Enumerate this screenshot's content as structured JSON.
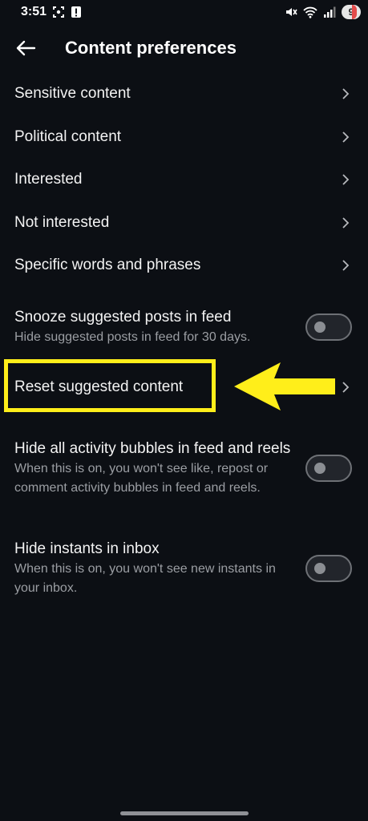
{
  "status_bar": {
    "time": "3:51",
    "battery_level": "9",
    "left_icons": [
      "screenshot-icon",
      "alert-icon"
    ],
    "right_icons": [
      "mute-icon",
      "wifi-icon",
      "signal-icon"
    ]
  },
  "header": {
    "title": "Content preferences",
    "back_icon": "back-arrow-icon"
  },
  "rows": [
    {
      "label": "Sensitive content",
      "control": "chevron"
    },
    {
      "label": "Political content",
      "control": "chevron"
    },
    {
      "label": "Interested",
      "control": "chevron"
    },
    {
      "label": "Not interested",
      "control": "chevron"
    },
    {
      "label": "Specific words and phrases",
      "control": "chevron"
    },
    {
      "label": "Snooze suggested posts in feed",
      "subtitle": "Hide suggested posts in feed for 30 days.",
      "control": "toggle",
      "on": false
    },
    {
      "label": "Reset suggested content",
      "control": "chevron",
      "highlighted": true
    },
    {
      "label": "Hide all activity bubbles in feed and reels",
      "subtitle": "When this is on, you won't see like, repost or comment activity bubbles in feed and reels.",
      "control": "toggle",
      "on": false
    },
    {
      "label": "Hide instants in inbox",
      "subtitle": "When this is on, you won't see new instants in your inbox.",
      "control": "toggle",
      "on": false
    }
  ],
  "annotation": {
    "highlight_color": "#ffee1a",
    "arrow_color": "#ffee1a"
  },
  "colors": {
    "background": "#0c0f14",
    "text_primary": "#f3f3f3",
    "text_secondary": "#9b9ea3"
  }
}
